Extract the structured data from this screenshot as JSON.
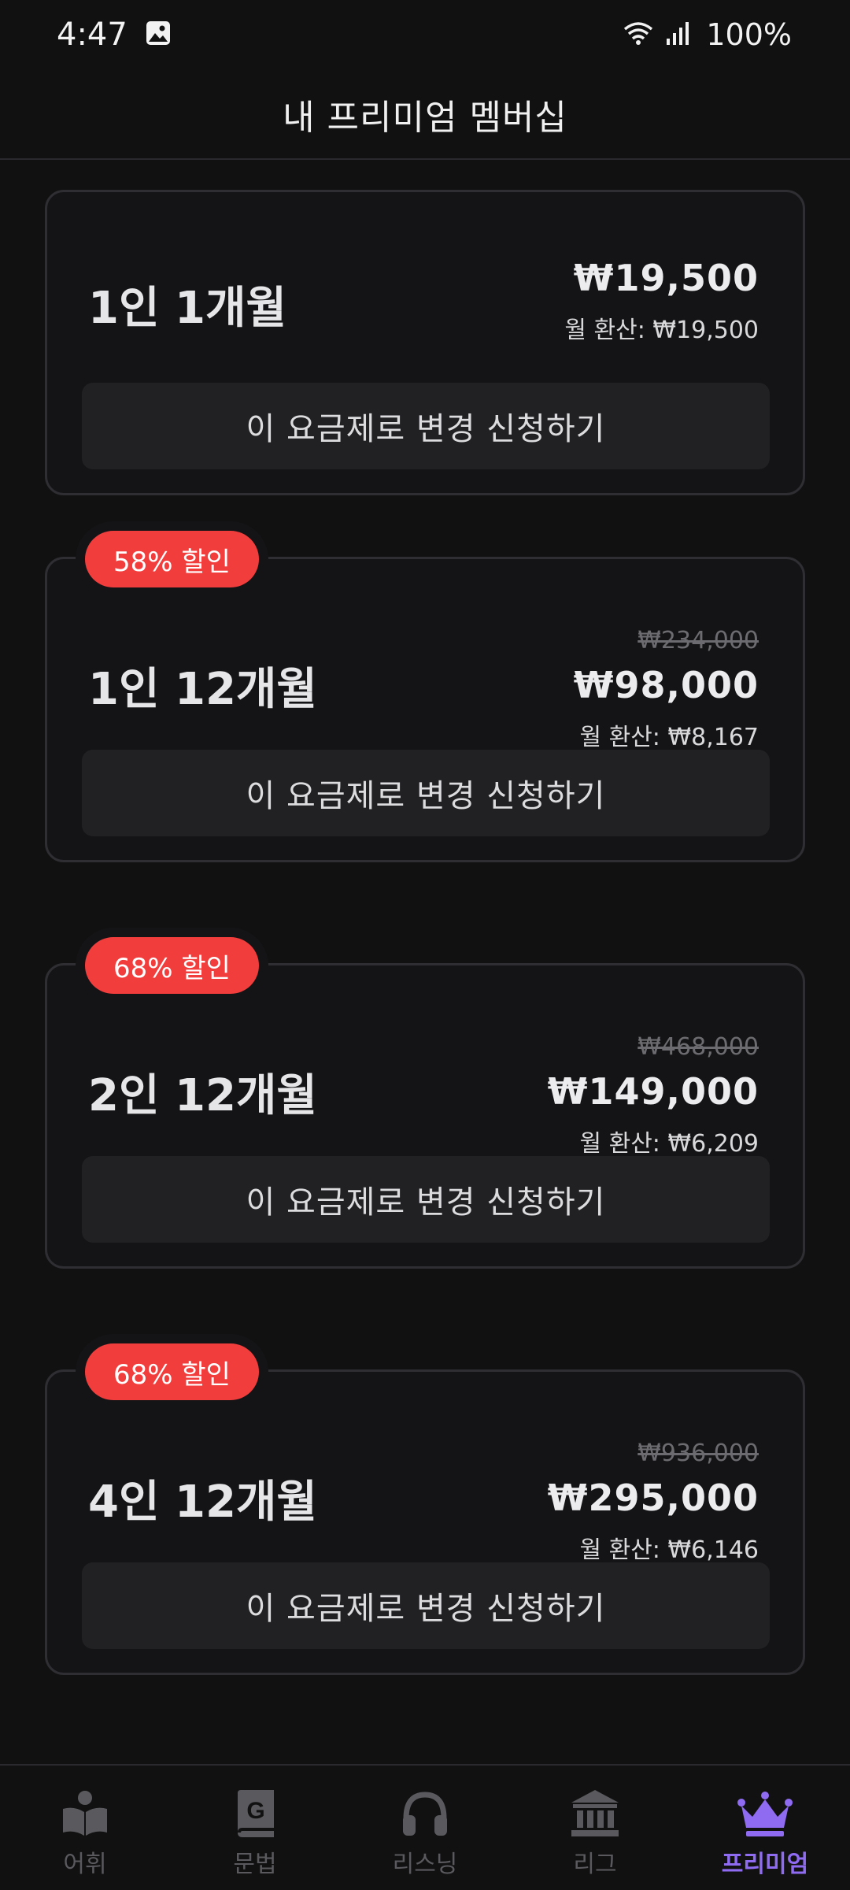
{
  "status": {
    "time": "4:47",
    "battery": "100%"
  },
  "header": {
    "title": "내 프리미엄 멤버십"
  },
  "plans": [
    {
      "name": "1인 1개월",
      "price": "₩19,500",
      "monthly": "월 환산: ₩19,500",
      "button": "이 요금제로 변경 신청하기"
    },
    {
      "badge": "58% 할인",
      "name": "1인 12개월",
      "original_price": "₩234,000",
      "price": "₩98,000",
      "monthly": "월 환산: ₩8,167",
      "button": "이 요금제로 변경 신청하기"
    },
    {
      "badge": "68% 할인",
      "name": "2인 12개월",
      "original_price": "₩468,000",
      "price": "₩149,000",
      "monthly": "월 환산: ₩6,209",
      "button": "이 요금제로 변경 신청하기"
    },
    {
      "badge": "68% 할인",
      "name": "4인 12개월",
      "original_price": "₩936,000",
      "price": "₩295,000",
      "monthly": "월 환산: ₩6,146",
      "button": "이 요금제로 변경 신청하기"
    }
  ],
  "nav": [
    {
      "label": "어휘",
      "icon": "book-reader-icon"
    },
    {
      "label": "문법",
      "icon": "grammar-book-icon"
    },
    {
      "label": "리스닝",
      "icon": "headphones-icon"
    },
    {
      "label": "리그",
      "icon": "bank-icon"
    },
    {
      "label": "프리미엄",
      "icon": "crown-icon",
      "active": true
    }
  ],
  "colors": {
    "accent": "#8f6bf2",
    "badge": "#f23d3d",
    "background": "#111112"
  }
}
